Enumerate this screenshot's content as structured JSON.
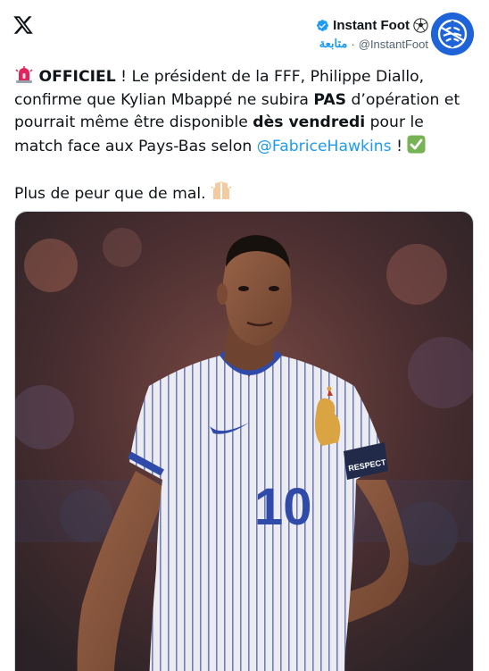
{
  "header": {
    "logo_icon": "x-logo-icon",
    "author_name": "Instant Foot",
    "verified_icon": "verified-badge-icon",
    "name_emoji": "soccer-ball-icon",
    "follow_label": "متابعة",
    "separator": "·",
    "handle": "@InstantFoot",
    "avatar_icon": "instant-foot-avatar"
  },
  "tweet": {
    "line1": {
      "emoji": "rotating-light-icon",
      "bold_word": "OFFICIEL",
      "text": " ! Le président de la FFF, Philippe Diallo,"
    },
    "line2": {
      "text_before": "confirme que Kylian Mbappé ne subira ",
      "bold_word": "PAS",
      "text_after": " d’opération et"
    },
    "line3": {
      "text_before": "pourrait même être disponible ",
      "bold_phrase": "dès vendredi",
      "text_after": " pour le"
    },
    "line4": {
      "text_before": "match face aux Pays-Bas selon ",
      "mention": "@FabriceHawkins",
      "text_after": " ! ",
      "emoji": "check-mark-button-icon"
    },
    "line5": {
      "text": "Plus de peur que de mal. ",
      "emoji": "raising-hands-icon"
    }
  },
  "media": {
    "jersey_number": "10",
    "armband_text": "RESPECT"
  },
  "colors": {
    "accent": "#1d9bf0",
    "text": "#0f1419",
    "muted": "#536471",
    "avatar_bg": "#1e63d8"
  }
}
